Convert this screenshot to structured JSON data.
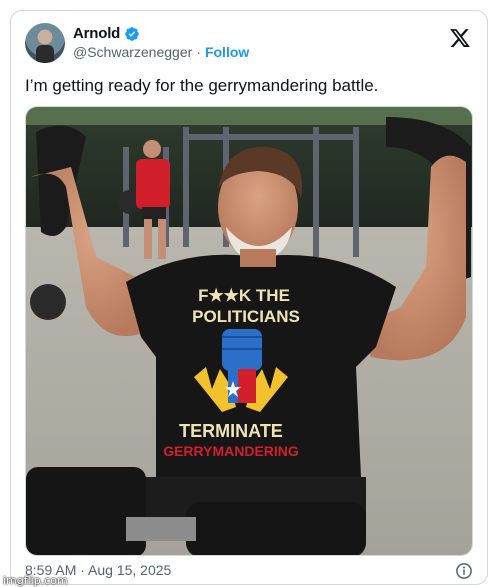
{
  "author": {
    "display_name": "Arnold",
    "handle": "@Schwarzenegger",
    "separator": "·",
    "follow_label": "Follow"
  },
  "tweet": {
    "text": "I’m getting ready for the gerrymandering battle.",
    "timestamp": "8:59 AM · Aug 15, 2025"
  },
  "image": {
    "shirt_text": {
      "line1": "F★★K THE",
      "line2": "POLITICIANS",
      "line3": "TERMINATE",
      "line4": "GERRYMANDERING"
    }
  },
  "icons": {
    "verified": "verified-badge-icon",
    "x_logo": "x-logo-icon",
    "info": "info-icon"
  },
  "colors": {
    "accent": "#1d9bf0",
    "secondary_text": "#536471",
    "border": "#cfd9de"
  },
  "watermark": "imgflip.com"
}
